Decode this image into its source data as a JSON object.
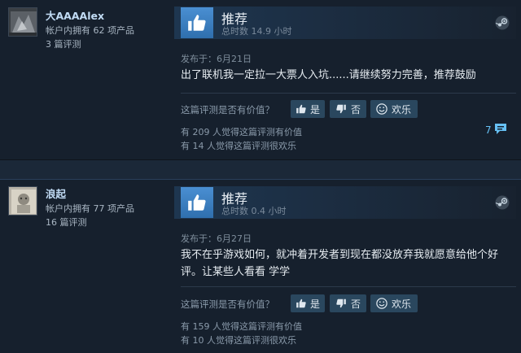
{
  "reviews": [
    {
      "username": "大AAAAlex",
      "products_owned": "帐户内拥有 62 项产品",
      "review_count": "3 篇评测",
      "verdict": "推荐",
      "hours": "总时数 14.9 小时",
      "posted": "发布于：6月21日",
      "text": "出了联机我一定拉一大票人入坑......请继续努力完善，推荐鼓励",
      "helpful_question": "这篇评测是否有价值？",
      "yes_label": "是",
      "no_label": "否",
      "funny_label": "欢乐",
      "helpful_stat": "有 209 人觉得这篇评测有价值",
      "funny_stat": "有 14 人觉得这篇评测很欢乐",
      "comments": "7"
    },
    {
      "username": "浪起",
      "products_owned": "帐户内拥有 77 项产品",
      "review_count": "16 篇评测",
      "verdict": "推荐",
      "hours": "总时数 0.4 小时",
      "posted": "发布于：6月27日",
      "text": "我不在乎游戏如何，就冲着开发者到现在都没放弃我就愿意给他个好评。让某些人看看 学学",
      "helpful_question": "这篇评测是否有价值？",
      "yes_label": "是",
      "no_label": "否",
      "funny_label": "欢乐",
      "helpful_stat": "有 159 人觉得这篇评测有价值",
      "funny_stat": "有 10 人觉得这篇评测很欢乐"
    }
  ],
  "colors": {
    "background": "#16202d",
    "accent": "#66c0f4",
    "thumb_blue": "#4a8fd2",
    "button_bg": "#2a475e"
  },
  "icons": [
    "thumbs-up-icon",
    "thumbs-down-icon",
    "smiley-icon",
    "steam-logo-icon",
    "comment-bubble-icon"
  ]
}
